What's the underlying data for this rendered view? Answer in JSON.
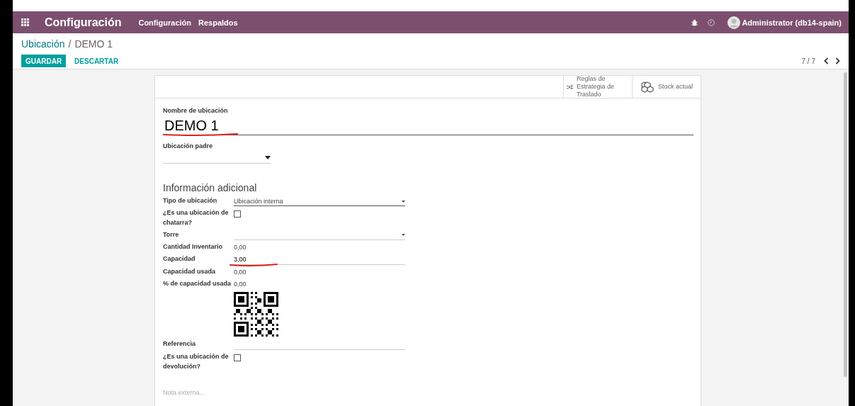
{
  "navbar": {
    "app_title": "Configuración",
    "menu": [
      "Configuración",
      "Respaldos"
    ],
    "user": "Administrator (db14-spain)"
  },
  "breadcrumb": {
    "parent": "Ubicación",
    "separator": "/",
    "current": "DEMO 1"
  },
  "buttons": [
    {
      "label": "GUARDAR",
      "kind": "primary"
    },
    {
      "label": "DESCARTAR",
      "kind": "link"
    }
  ],
  "pager": {
    "value": "7 / 7"
  },
  "smart_buttons": [
    {
      "label": "Reglas de Estrategia de Traslado",
      "kind": "shuffle"
    },
    {
      "label": "Stock actual",
      "kind": "cubes"
    }
  ],
  "name_field": {
    "label": "Nombre de ubicación",
    "value": "DEMO 1",
    "annotated": true
  },
  "parent_field": {
    "label": "Ubicación padre"
  },
  "section_title": "Información adicional",
  "fields": [
    {
      "kind": "select",
      "label": "Tipo de ubicación",
      "value": "Ubicación interna"
    },
    {
      "kind": "checkbox",
      "label": "¿Es una ubicación de chatarra?",
      "checked": false
    },
    {
      "kind": "select",
      "label": "Torre"
    },
    {
      "kind": "text",
      "label": "Cantidad Inventario",
      "value": "0,00"
    },
    {
      "kind": "input",
      "label": "Capacidad",
      "value": "3,00",
      "annotated": true
    },
    {
      "kind": "text",
      "label": "Capacidad usada",
      "value": "0,00"
    },
    {
      "kind": "text",
      "label": "% de capacidad usada",
      "value": "0,00"
    },
    {
      "kind": "qr"
    },
    {
      "kind": "input",
      "label": "Referencia"
    },
    {
      "kind": "checkbox",
      "label": "¿Es una ubicación de devolución?",
      "checked": false
    }
  ],
  "note": {
    "placeholder": "Nota externa..."
  }
}
